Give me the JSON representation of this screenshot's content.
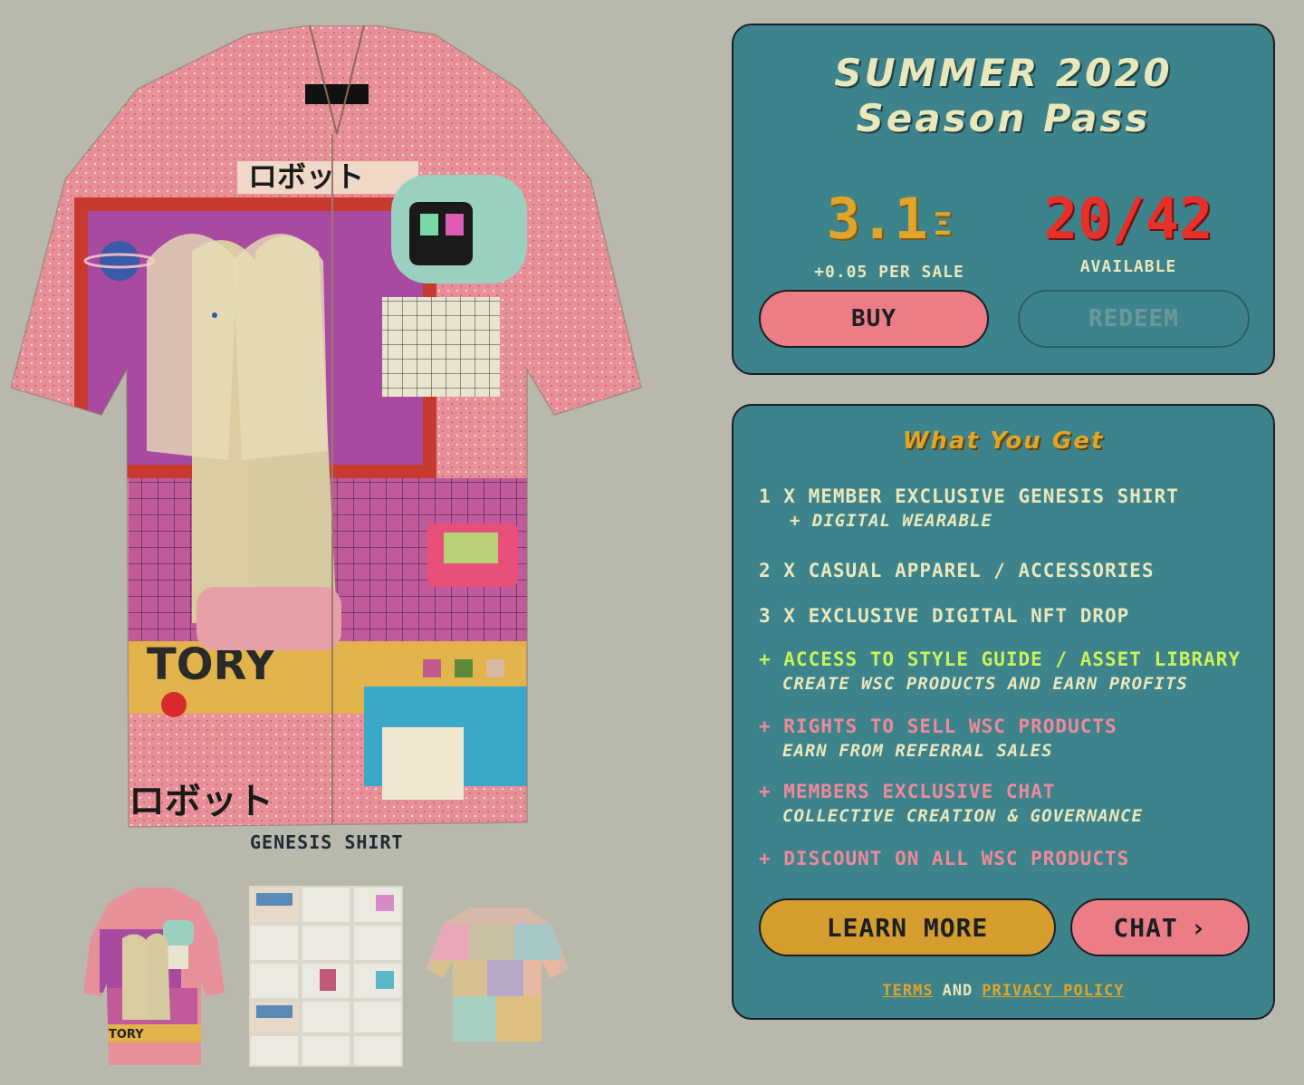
{
  "product": {
    "caption": "GENESIS SHIRT",
    "thumbnails": [
      "shirt-front",
      "style-guide-sheet",
      "digital-wearable"
    ]
  },
  "season_pass": {
    "title_line1": "SUMMER 2020",
    "title_line2": "Season Pass",
    "price": "3.1",
    "price_unit_icon": "eth-icon",
    "price_unit_glyph": "Ξ",
    "price_note": "+0.05 PER SALE",
    "availability": "20/42",
    "availability_label": "AVAILABLE",
    "buy_label": "BUY",
    "redeem_label": "REDEEM"
  },
  "what_you_get": {
    "title": "What You Get",
    "items": [
      {
        "main": "1 X MEMBER EXCLUSIVE GENESIS SHIRT",
        "sub": "+ DIGITAL WEARABLE"
      },
      {
        "main": "2 X CASUAL APPAREL / ACCESSORIES"
      },
      {
        "main": "3 X EXCLUSIVE DIGITAL NFT DROP"
      },
      {
        "main": "+ ACCESS TO STYLE GUIDE / ASSET LIBRARY",
        "sub": "CREATE WSC PRODUCTS AND EARN PROFITS"
      },
      {
        "main": "+ RIGHTS TO SELL WSC PRODUCTS",
        "sub": "EARN FROM REFERRAL SALES"
      },
      {
        "main": "+ MEMBERS EXCLUSIVE CHAT",
        "sub": "COLLECTIVE CREATION & GOVERNANCE"
      },
      {
        "main": "+ DISCOUNT ON ALL WSC PRODUCTS"
      }
    ],
    "learn_more_label": "LEARN MORE",
    "chat_label": "CHAT",
    "chat_chevron": "›",
    "terms_label": "TERMS",
    "and_label": "AND",
    "privacy_label": "PRIVACY POLICY"
  },
  "colors": {
    "background": "#b8b9ac",
    "panel": "#3d838b",
    "cream": "#e9e7bc",
    "gold": "#e0a52a",
    "red": "#e8302a",
    "pink": "#ec7d86",
    "green": "#caf25a"
  }
}
